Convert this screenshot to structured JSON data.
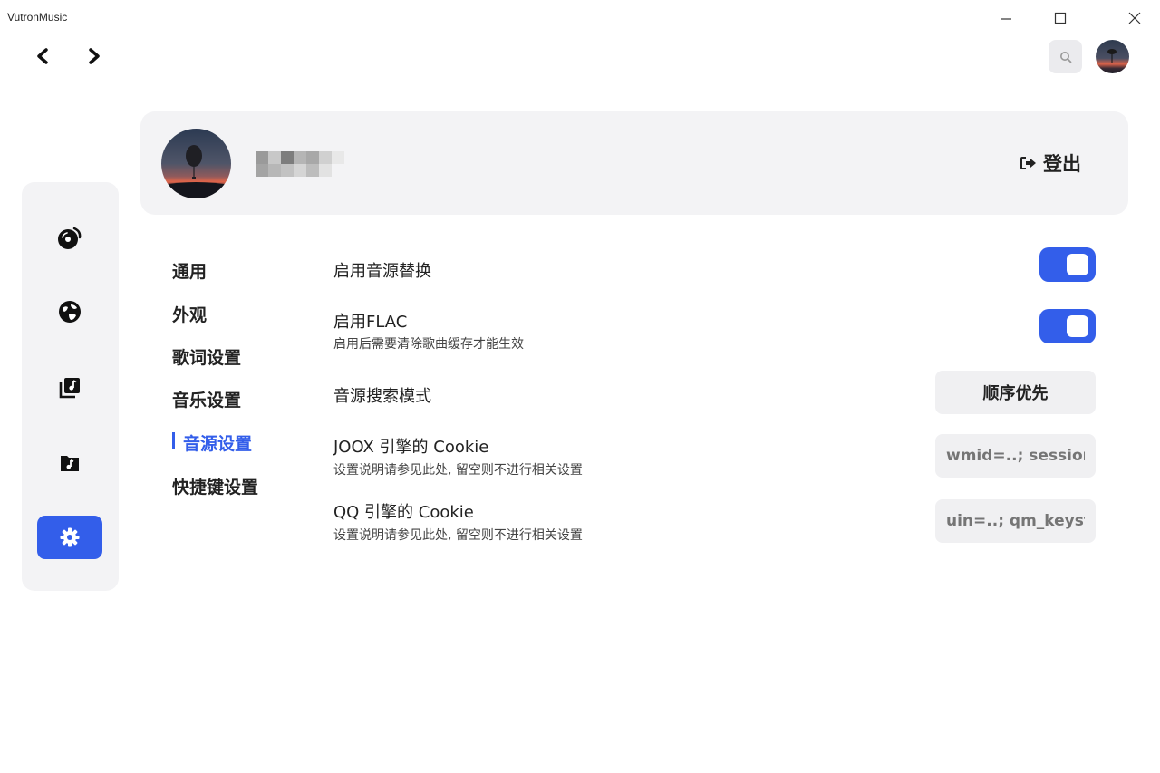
{
  "window": {
    "title": "VutronMusic",
    "controls": {
      "minimize_icon": "minimize-icon",
      "maximize_icon": "maximize-icon",
      "close_icon": "close-icon"
    }
  },
  "header": {
    "back_icon": "chevron-left-icon",
    "forward_icon": "chevron-right-icon",
    "search_icon": "search-icon",
    "avatar": "user-avatar"
  },
  "sidebar": {
    "items": [
      {
        "id": "home",
        "icon": "music-disc-icon",
        "active": false
      },
      {
        "id": "explore",
        "icon": "globe-icon",
        "active": false
      },
      {
        "id": "library",
        "icon": "music-library-icon",
        "active": false
      },
      {
        "id": "local-music",
        "icon": "music-folder-icon",
        "active": false
      },
      {
        "id": "settings",
        "icon": "gear-icon",
        "active": true
      }
    ]
  },
  "profile": {
    "logout_label": "登出",
    "logout_icon": "sign-out-icon"
  },
  "settings_nav": {
    "items": [
      {
        "label": "通用",
        "active": false
      },
      {
        "label": "外观",
        "active": false
      },
      {
        "label": "歌词设置",
        "active": false
      },
      {
        "label": "音乐设置",
        "active": false
      },
      {
        "label": "音源设置",
        "active": true
      },
      {
        "label": "快捷键设置",
        "active": false
      }
    ]
  },
  "settings": {
    "enable_source_replace": {
      "title": "启用音源替换",
      "enabled": true
    },
    "enable_flac": {
      "title": "启用FLAC",
      "subtitle": "启用后需要清除歌曲缓存才能生效",
      "enabled": true
    },
    "search_mode": {
      "title": "音源搜索模式",
      "value": "顺序优先"
    },
    "joox_cookie": {
      "title": "JOOX 引擎的 Cookie",
      "subtitle": "设置说明请参见此处, 留空则不进行相关设置",
      "placeholder": "wmid=..; session_key=.."
    },
    "qq_cookie": {
      "title": "QQ 引擎的 Cookie",
      "subtitle": "设置说明请参见此处, 留空则不进行相关设置",
      "placeholder": "uin=..; qm_keyst=.."
    }
  },
  "colors": {
    "accent": "#335eea",
    "card_bg": "#f3f3f5",
    "input_bg": "#f0f0f2"
  }
}
